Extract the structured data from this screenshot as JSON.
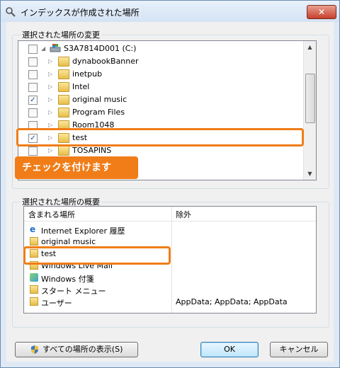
{
  "window": {
    "title": "インデックスが作成された場所",
    "close_glyph": "✕"
  },
  "change_section": {
    "label": "選択された場所の変更"
  },
  "tree": {
    "items": [
      {
        "label": "S3A7814D001 (C:)",
        "checked": false,
        "icon": "drive-icon"
      },
      {
        "label": "dynabookBanner",
        "checked": false,
        "icon": "folder-icon"
      },
      {
        "label": "inetpub",
        "checked": false,
        "icon": "folder-icon"
      },
      {
        "label": "Intel",
        "checked": false,
        "icon": "folder-icon"
      },
      {
        "label": "original music",
        "checked": true,
        "icon": "folder-icon"
      },
      {
        "label": "Program Files",
        "checked": false,
        "icon": "folder-icon"
      },
      {
        "label": "Room1048",
        "checked": false,
        "icon": "folder-icon"
      },
      {
        "label": "test",
        "checked": true,
        "icon": "folder-icon"
      },
      {
        "label": "TOSAPINS",
        "checked": false,
        "icon": "folder-icon"
      }
    ],
    "callout": "チェックを付けます"
  },
  "summary_section": {
    "label": "選択された場所の概要",
    "headers": {
      "included": "含まれる場所",
      "excluded": "除外"
    },
    "rows": [
      {
        "label": "Internet Explorer 履歴",
        "excluded": "",
        "icon": "ie-icon"
      },
      {
        "label": "original music",
        "excluded": "",
        "icon": "folder-icon"
      },
      {
        "label": "test",
        "excluded": "",
        "icon": "folder-icon"
      },
      {
        "label": "Windows Live Mail",
        "excluded": "",
        "icon": "folder-icon"
      },
      {
        "label": "Windows 付箋",
        "excluded": "",
        "icon": "notes-icon"
      },
      {
        "label": "スタート メニュー",
        "excluded": "",
        "icon": "folder-icon"
      },
      {
        "label": "ユーザー",
        "excluded": "AppData; AppData; AppData",
        "icon": "folder-icon"
      }
    ]
  },
  "buttons": {
    "show_all": "すべての場所の表示(S)",
    "ok": "OK",
    "cancel": "キャンセル"
  },
  "colors": {
    "highlight": "#f07d18",
    "check": "#1a4e9a"
  }
}
